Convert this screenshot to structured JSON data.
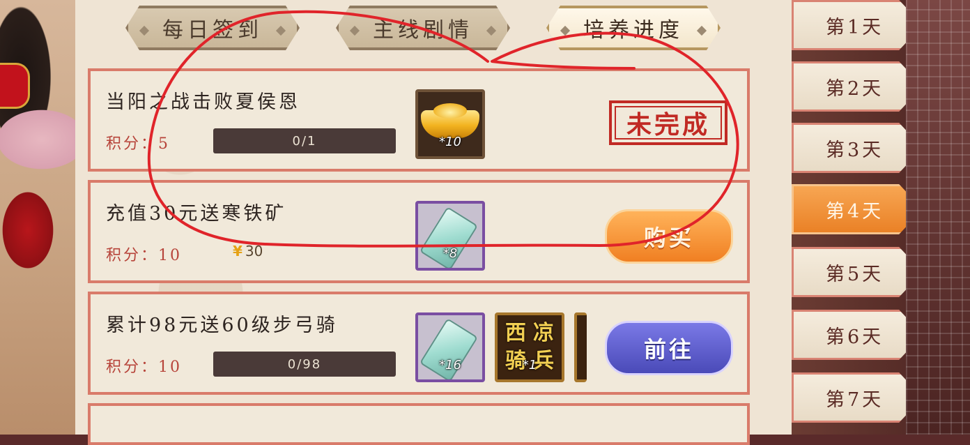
{
  "tabs": [
    {
      "label": "每日签到",
      "active": false
    },
    {
      "label": "主线剧情",
      "active": false
    },
    {
      "label": "培养进度",
      "active": true
    }
  ],
  "tasks": [
    {
      "title": "当阳之战击败夏侯恩",
      "points": "积分：5",
      "progress": {
        "text": "0/1",
        "current": 0,
        "total": 1
      },
      "rewards": [
        {
          "icon": "gold-ingot-icon",
          "qty": "*10"
        }
      ],
      "status": "未完成"
    },
    {
      "title": "充值30元送寒铁矿",
      "points": "积分：10",
      "price": "30",
      "price_icon": "coin-icon",
      "rewards": [
        {
          "icon": "cold-iron-ore-icon",
          "qty": "*8"
        }
      ],
      "button": "购买"
    },
    {
      "title": "累计98元送60级步弓骑",
      "points": "积分：10",
      "progress": {
        "text": "0/98",
        "current": 0,
        "total": 98
      },
      "rewards": [
        {
          "icon": "cold-iron-ore-icon",
          "qty": "*16"
        },
        {
          "icon": "xiliang-cavalry-card-icon",
          "qty": "*1",
          "card_text": [
            "西",
            "凉",
            "骑",
            "兵"
          ]
        }
      ],
      "button": "前往"
    }
  ],
  "days": [
    {
      "label": "第1天",
      "active": false
    },
    {
      "label": "第2天",
      "active": false
    },
    {
      "label": "第3天",
      "active": false
    },
    {
      "label": "第4天",
      "active": true
    },
    {
      "label": "第5天",
      "active": false
    },
    {
      "label": "第6天",
      "active": false
    },
    {
      "label": "第7天",
      "active": false
    }
  ],
  "colors": {
    "stamp": "#c12a24",
    "buy_button": "#f07f22",
    "goto_button": "#4a4ab8",
    "active_day": "#ea8126",
    "annotation": "#e0242a"
  }
}
